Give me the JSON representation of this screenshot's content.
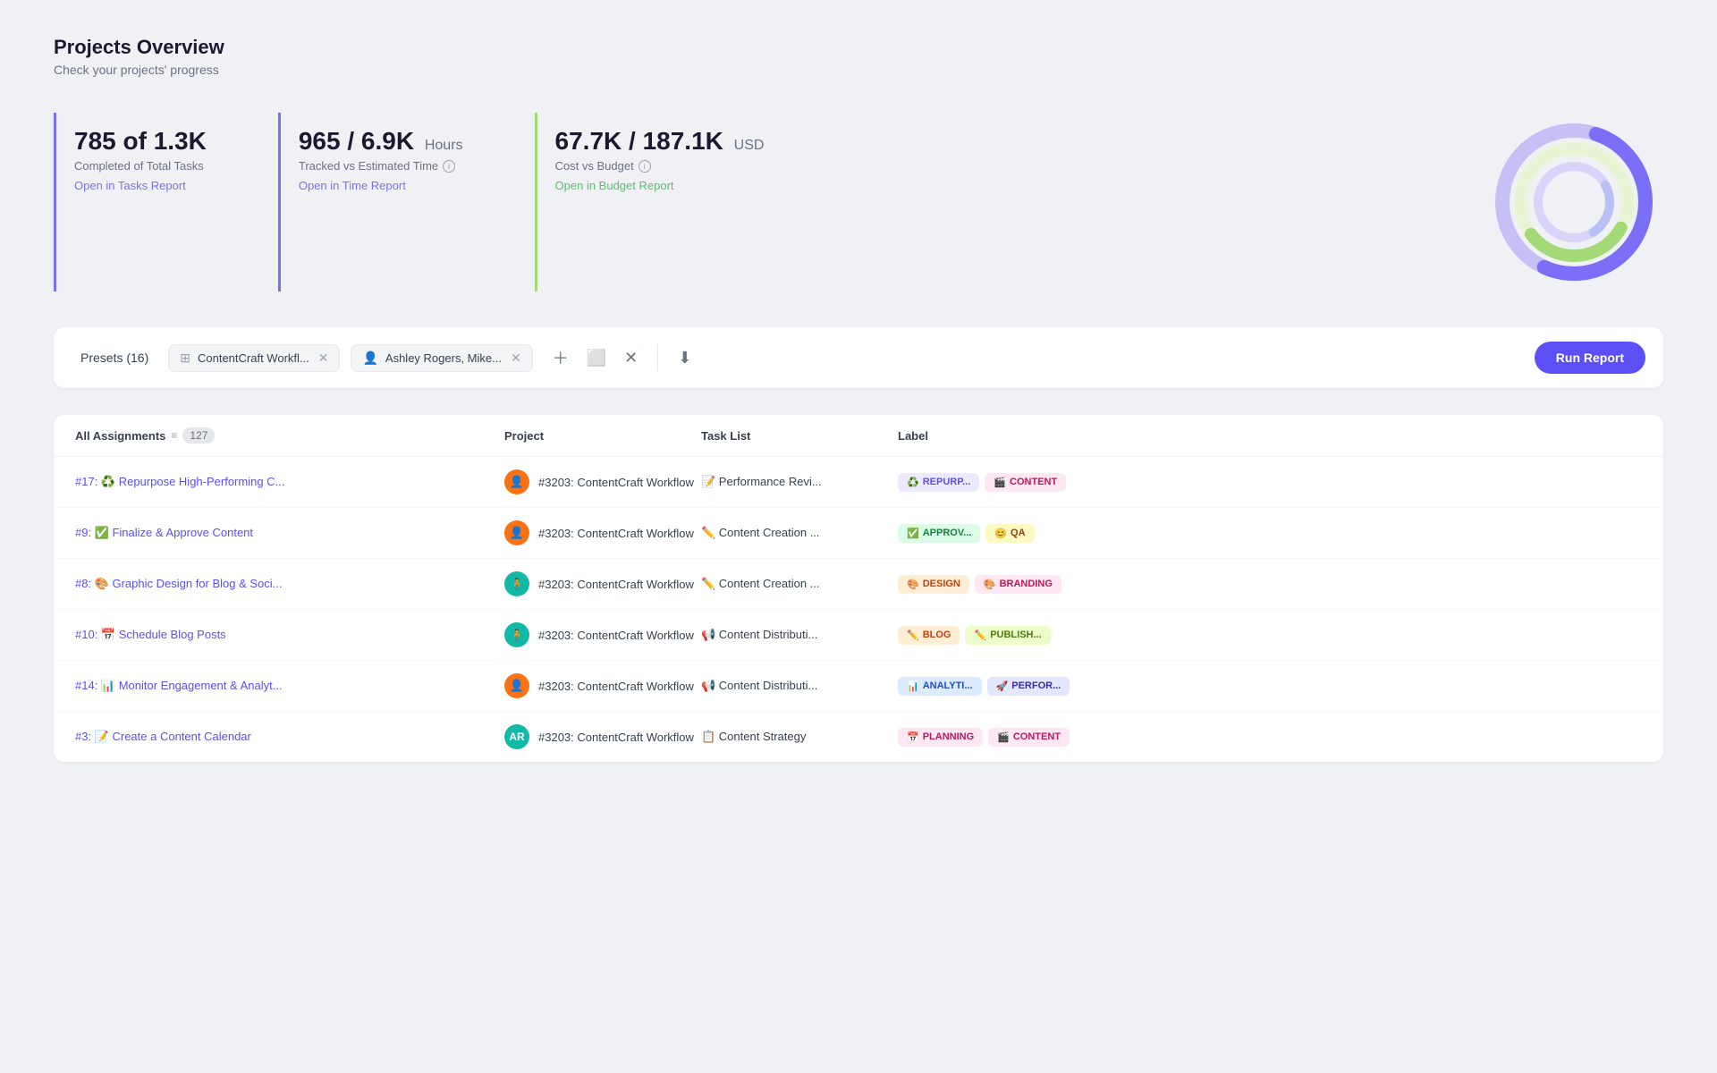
{
  "header": {
    "title": "Projects Overview",
    "subtitle": "Check your projects' progress"
  },
  "stats": [
    {
      "id": "tasks",
      "value": "785 of 1.3K",
      "unit": "",
      "label": "Completed of Total Tasks",
      "link": "Open in Tasks Report",
      "link_class": "purple",
      "border_color": "#7c6ff7",
      "has_info": false
    },
    {
      "id": "time",
      "value": "965 / 6.9K",
      "unit": "Hours",
      "label": "Tracked vs Estimated Time",
      "link": "Open in Time Report",
      "link_class": "purple",
      "border_color": "#7c6ff7",
      "has_info": true
    },
    {
      "id": "budget",
      "value": "67.7K / 187.1K",
      "unit": "USD",
      "label": "Cost vs Budget",
      "link": "Open in Budget Report",
      "link_class": "green",
      "border_color": "#a3d977",
      "has_info": true
    }
  ],
  "donut": {
    "segments": [
      {
        "color": "#7c6ff7",
        "value": 40,
        "offset": 0
      },
      {
        "color": "#a3d977",
        "value": 30,
        "offset": 40
      },
      {
        "color": "#b8c4f5",
        "value": 30,
        "offset": 70
      }
    ]
  },
  "filter_bar": {
    "presets_label": "Presets (16)",
    "filters": [
      {
        "icon": "⊞",
        "label": "ContentCraft Workfl...",
        "has_close": true
      },
      {
        "icon": "👤",
        "label": "Ashley Rogers, Mike...",
        "has_close": true
      }
    ],
    "run_button": "Run Report"
  },
  "table": {
    "columns": [
      "All Assignments",
      "Project",
      "Task List",
      "Label"
    ],
    "assignment_count": "127",
    "rows": [
      {
        "id": "#17",
        "emoji": "♻️",
        "title": "Repurpose High-Performing C...",
        "avatar": "👤",
        "avatar_color": "orange",
        "project": "#3203: ContentCraft Workflow",
        "tasklist_emoji": "📝",
        "tasklist": "Performance Revi...",
        "labels": [
          {
            "emoji": "♻️",
            "text": "REPURP...",
            "class": "purple-bg"
          },
          {
            "emoji": "🎬",
            "text": "CONTENT",
            "class": "pink-bg"
          }
        ]
      },
      {
        "id": "#9",
        "emoji": "✅",
        "title": "Finalize & Approve Content",
        "avatar": "👤",
        "avatar_color": "orange",
        "project": "#3203: ContentCraft Workflow",
        "tasklist_emoji": "✏️",
        "tasklist": "Content Creation ...",
        "labels": [
          {
            "emoji": "✅",
            "text": "APPROV...",
            "class": "green-bg"
          },
          {
            "emoji": "😊",
            "text": "QA",
            "class": "yellow-bg"
          }
        ]
      },
      {
        "id": "#8",
        "emoji": "🎨",
        "title": "Graphic Design for Blog & Soci...",
        "avatar": "🧍",
        "avatar_color": "teal",
        "project": "#3203: ContentCraft Workflow",
        "tasklist_emoji": "✏️",
        "tasklist": "Content Creation ...",
        "labels": [
          {
            "emoji": "🎨",
            "text": "DESIGN",
            "class": "orange-bg"
          },
          {
            "emoji": "🎨",
            "text": "BRANDING",
            "class": "pink-bg"
          }
        ]
      },
      {
        "id": "#10",
        "emoji": "📅",
        "title": "Schedule Blog Posts",
        "avatar": "🧍",
        "avatar_color": "teal",
        "project": "#3203: ContentCraft Workflow",
        "tasklist_emoji": "📢",
        "tasklist": "Content Distributi...",
        "labels": [
          {
            "emoji": "✏️",
            "text": "BLOG",
            "class": "orange-bg"
          },
          {
            "emoji": "✏️",
            "text": "PUBLISH...",
            "class": "lime-bg"
          }
        ]
      },
      {
        "id": "#14",
        "emoji": "📊",
        "title": "Monitor Engagement & Analyt...",
        "avatar": "👤",
        "avatar_color": "orange",
        "project": "#3203: ContentCraft Workflow",
        "tasklist_emoji": "📢",
        "tasklist": "Content Distributi...",
        "labels": [
          {
            "emoji": "📊",
            "text": "ANALYTI...",
            "class": "blue-bg"
          },
          {
            "emoji": "🚀",
            "text": "PERFOR...",
            "class": "indigo-bg"
          }
        ]
      },
      {
        "id": "#3",
        "emoji": "📝",
        "title": "Create a Content Calendar",
        "avatar": "AR",
        "avatar_color": "teal",
        "project": "#3203: ContentCraft Workflow",
        "tasklist_emoji": "📋",
        "tasklist": "Content Strategy",
        "labels": [
          {
            "emoji": "📅",
            "text": "PLANNING",
            "class": "pink-bg"
          },
          {
            "emoji": "🎬",
            "text": "CONTENT",
            "class": "pink-bg"
          }
        ]
      }
    ]
  }
}
